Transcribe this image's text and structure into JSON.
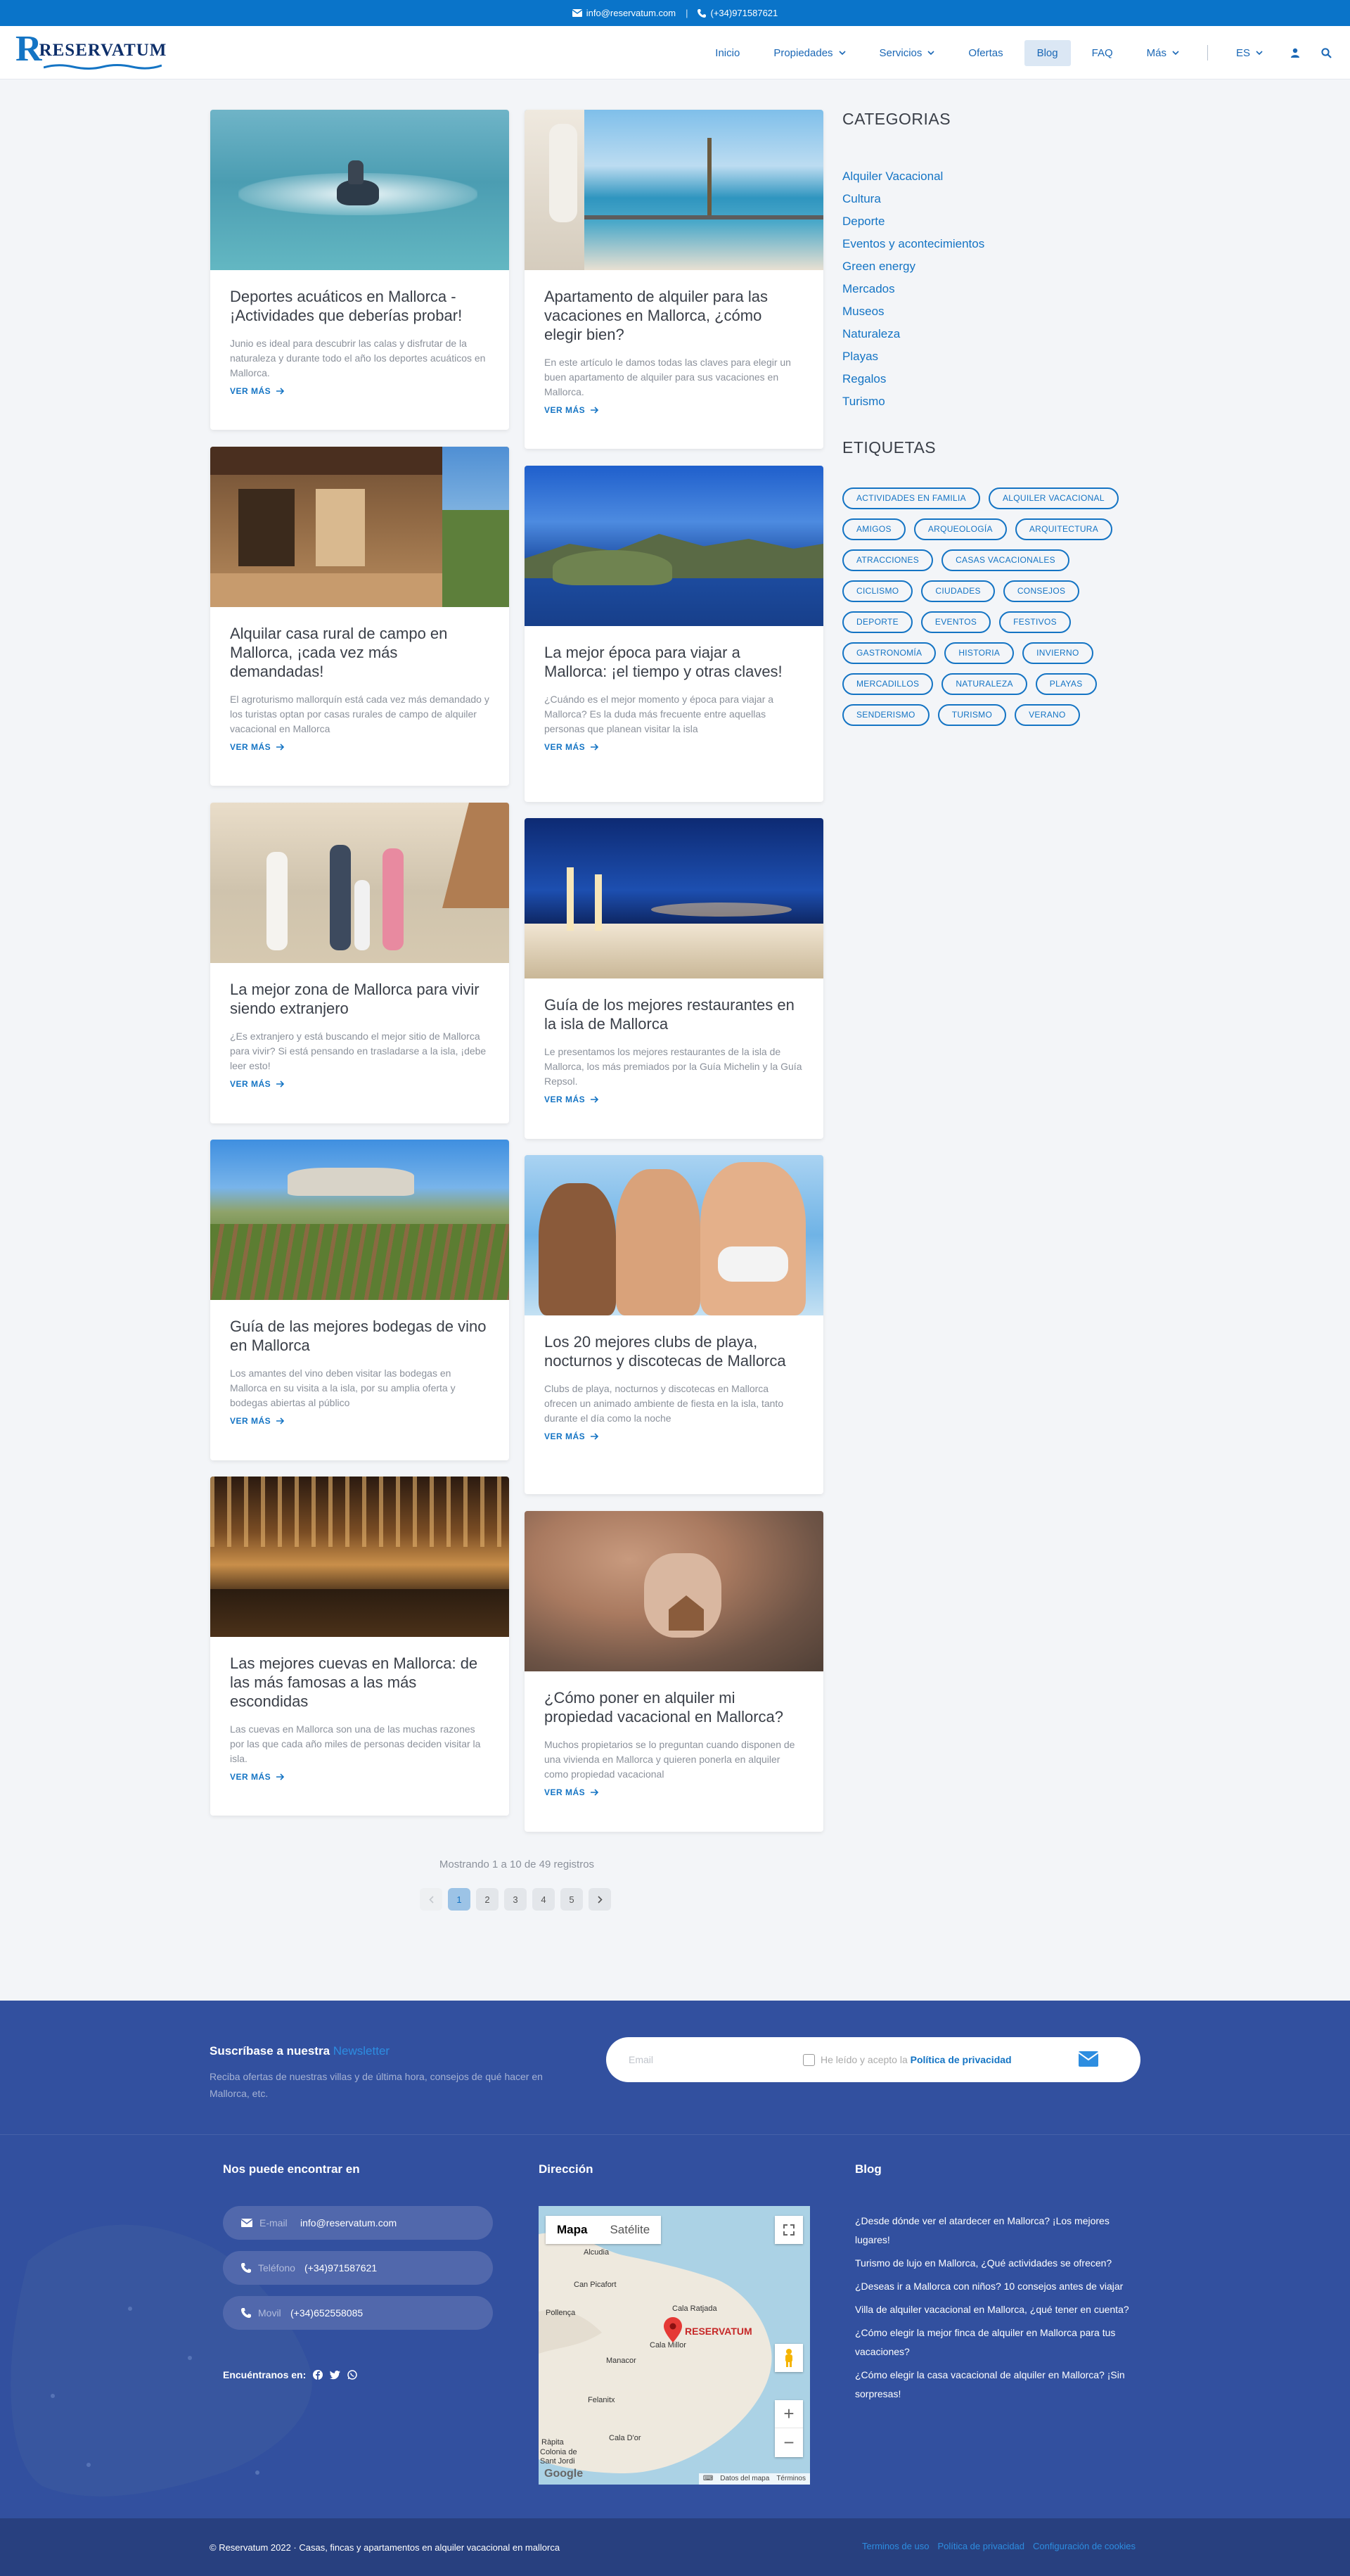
{
  "topbar": {
    "email": "info@reservatum.com",
    "phone": "(+34)971587621"
  },
  "logo": {
    "first": "R",
    "rest": "RESERVATUM"
  },
  "nav": {
    "items": [
      {
        "label": "Inicio",
        "dropdown": false
      },
      {
        "label": "Propiedades",
        "dropdown": true
      },
      {
        "label": "Servicios",
        "dropdown": true
      },
      {
        "label": "Ofertas",
        "dropdown": false
      },
      {
        "label": "Blog",
        "dropdown": false,
        "active": true
      },
      {
        "label": "FAQ",
        "dropdown": false
      },
      {
        "label": "Más",
        "dropdown": true
      }
    ],
    "lang": "ES"
  },
  "posts": [
    {
      "title": "Deportes acuáticos en Mallorca - ¡Actividades que deberías probar!",
      "excerpt": "Junio es ideal para descubrir las calas y disfrutar de la naturaleza y durante todo el año los deportes acuáticos en Mallorca.",
      "more": "VER MÁS"
    },
    {
      "title": "Apartamento de alquiler para las vacaciones en Mallorca, ¿cómo elegir bien?",
      "excerpt": "En este artículo le damos todas las claves para elegir un buen apartamento de alquiler para sus vacaciones en Mallorca.",
      "more": "VER MÁS"
    },
    {
      "title": "Alquilar casa rural de campo en Mallorca, ¡cada vez más demandadas!",
      "excerpt": "El agroturismo mallorquín está cada vez más demandado y los turistas optan por casas rurales de campo de alquiler vacacional en Mallorca",
      "more": "VER MÁS"
    },
    {
      "title": "La mejor época para viajar a Mallorca: ¡el tiempo y otras claves!",
      "excerpt": "¿Cuándo es el mejor momento y época para viajar a Mallorca? Es la duda más frecuente entre aquellas personas que planean visitar la isla",
      "more": "VER MÁS"
    },
    {
      "title": "La mejor zona de Mallorca para vivir siendo extranjero",
      "excerpt": "¿Es extranjero y está buscando el mejor sitio de Mallorca para vivir? Si está pensando en trasladarse a la isla, ¡debe leer esto!",
      "more": "VER MÁS"
    },
    {
      "title": "Guía de los mejores restaurantes en la isla de Mallorca",
      "excerpt": "Le presentamos los mejores restaurantes de la isla de Mallorca, los más premiados por la Guía Michelin y la Guía Repsol.",
      "more": "VER MÁS"
    },
    {
      "title": "Guía de las mejores bodegas de vino en Mallorca",
      "excerpt": "Los amantes del vino deben visitar las bodegas en Mallorca en su visita a la isla, por su amplia oferta y bodegas abiertas al público",
      "more": "VER MÁS"
    },
    {
      "title": "Los 20 mejores clubs de playa, nocturnos y discotecas de Mallorca",
      "excerpt": "Clubs de playa, nocturnos y discotecas en Mallorca ofrecen un animado ambiente de fiesta en la isla, tanto durante el día como la noche",
      "more": "VER MÁS"
    },
    {
      "title": "Las mejores cuevas en Mallorca: de las más famosas a las más escondidas",
      "excerpt": "Las cuevas en Mallorca son una de las muchas razones por las que cada año miles de personas deciden visitar la isla.",
      "more": "VER MÁS"
    },
    {
      "title": "¿Cómo poner en alquiler mi propiedad vacacional en Mallorca?",
      "excerpt": "Muchos propietarios se lo preguntan cuando disponen de una vivienda en Mallorca y quieren ponerla en alquiler como propiedad vacacional",
      "more": "VER MÁS"
    }
  ],
  "sidebar": {
    "categories_title": "CATEGORIAS",
    "categories": [
      "Alquiler Vacacional",
      "Cultura",
      "Deporte",
      "Eventos y acontecimientos",
      "Green energy",
      "Mercados",
      "Museos",
      "Naturaleza",
      "Playas",
      "Regalos",
      "Turismo"
    ],
    "tags_title": "ETIQUETAS",
    "tags": [
      "ACTIVIDADES EN FAMILIA",
      "ALQUILER VACACIONAL",
      "AMIGOS",
      "ARQUEOLOGÍA",
      "ARQUITECTURA",
      "ATRACCIONES",
      "CASAS VACACIONALES",
      "CICLISMO",
      "CIUDADES",
      "CONSEJOS",
      "DEPORTE",
      "EVENTOS",
      "FESTIVOS",
      "GASTRONOMÍA",
      "HISTORIA",
      "INVIERNO",
      "MERCADILLOS",
      "NATURALEZA",
      "PLAYAS",
      "SENDERISMO",
      "TURISMO",
      "VERANO"
    ]
  },
  "pagination": {
    "text": "Mostrando 1 a 10 de 49 registros",
    "pages": [
      "1",
      "2",
      "3",
      "4",
      "5"
    ],
    "current": "1"
  },
  "footer": {
    "newsletter_title": "Suscríbase a nuestra",
    "newsletter_highlight": "Newsletter",
    "newsletter_text": "Reciba ofertas de nuestras villas y de última hora, consejos de qué hacer en Mallorca, etc.",
    "email_placeholder": "Email",
    "privacy_prefix": "He leído y acepto la",
    "privacy_link": "Política de privacidad",
    "find_title": "Nos puede encontrar en",
    "contacts": [
      {
        "label": "E-mail",
        "value": "info@reservatum.com",
        "icon": "mail-icon"
      },
      {
        "label": "Teléfono",
        "value": "(+34)971587621",
        "icon": "phone-icon"
      },
      {
        "label": "Movil",
        "value": "(+34)652558085",
        "icon": "phone-icon"
      }
    ],
    "follow": "Encuéntranos en:",
    "address_title": "Dirección",
    "map": {
      "tab_map": "Mapa",
      "tab_sat": "Satélite",
      "marker": "RESERVATUM",
      "places": [
        "Alcudia",
        "Can Picafort",
        "Cala Ratjada",
        "Pollença",
        "Manacor",
        "Cala Millor",
        "Felanitx",
        "Ràpita",
        "Cala D'or",
        "Colonia de Sant Jordi"
      ],
      "brand": "Google",
      "attrib": "Datos del mapa",
      "terms": "Términos"
    },
    "blog_title": "Blog",
    "blog_links": [
      "¿Desde dónde ver el atardecer en Mallorca? ¡Los mejores lugares!",
      "Turismo de lujo en Mallorca, ¿Qué actividades se ofrecen?",
      "¿Deseas ir a Mallorca con niños? 10 consejos antes de viajar",
      "Villa de alquiler vacacional en Mallorca, ¿qué tener en cuenta?",
      "¿Cómo elegir la mejor finca de alquiler en Mallorca para tus vacaciones?",
      "¿Cómo elegir la casa vacacional de alquiler en Mallorca? ¡Sin sorpresas!"
    ],
    "copyright": "© Reservatum 2022 · Casas, fincas y apartamentos en alquiler vacacional en mallorca",
    "legal": [
      "Terminos de uso",
      "Política de privacidad",
      "Configuración de cookies"
    ]
  },
  "colors": {
    "brand": "#1474c4",
    "topbar": "#0a74c9",
    "footer": "#32509f",
    "footer_bottom": "#28407f"
  }
}
